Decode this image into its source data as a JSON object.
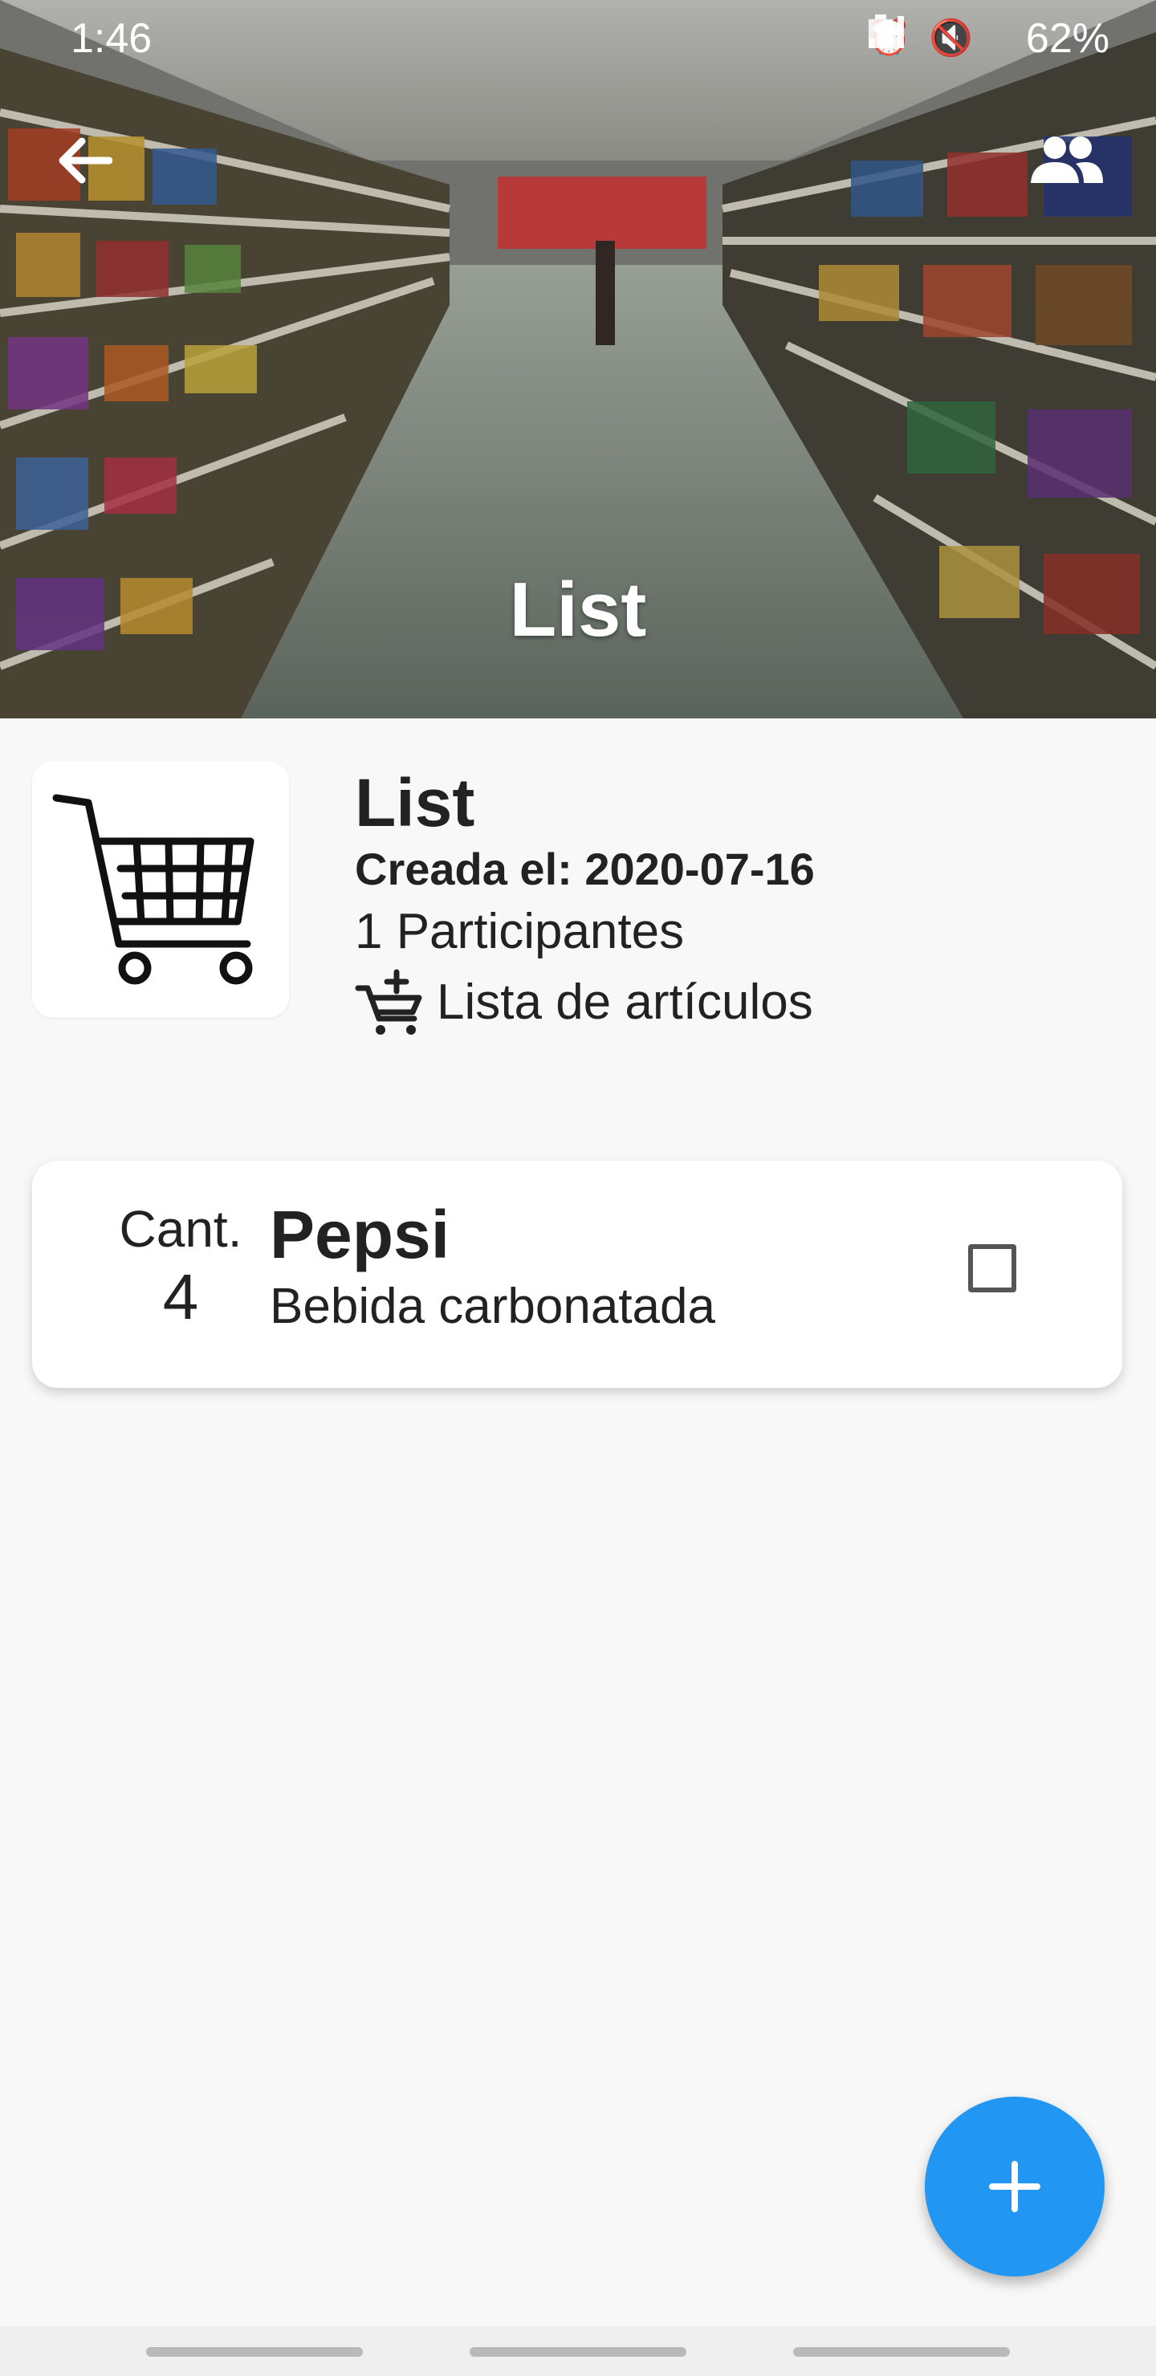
{
  "status_bar": {
    "time": "1:46",
    "battery": "62%"
  },
  "header": {
    "title": "List",
    "back_icon": "arrow-back-icon",
    "participants_icon": "people-icon"
  },
  "list_info": {
    "title": "List",
    "created": "Creada el: 2020-07-16",
    "participants": "1 Participantes",
    "items_link": "Lista de artículos"
  },
  "items": [
    {
      "qty_label": "Cant.",
      "qty": "4",
      "name": "Pepsi",
      "description": "Bebida carbonatada",
      "checked": false
    }
  ],
  "fab": {
    "icon": "plus-icon",
    "color": "#2196f3"
  }
}
